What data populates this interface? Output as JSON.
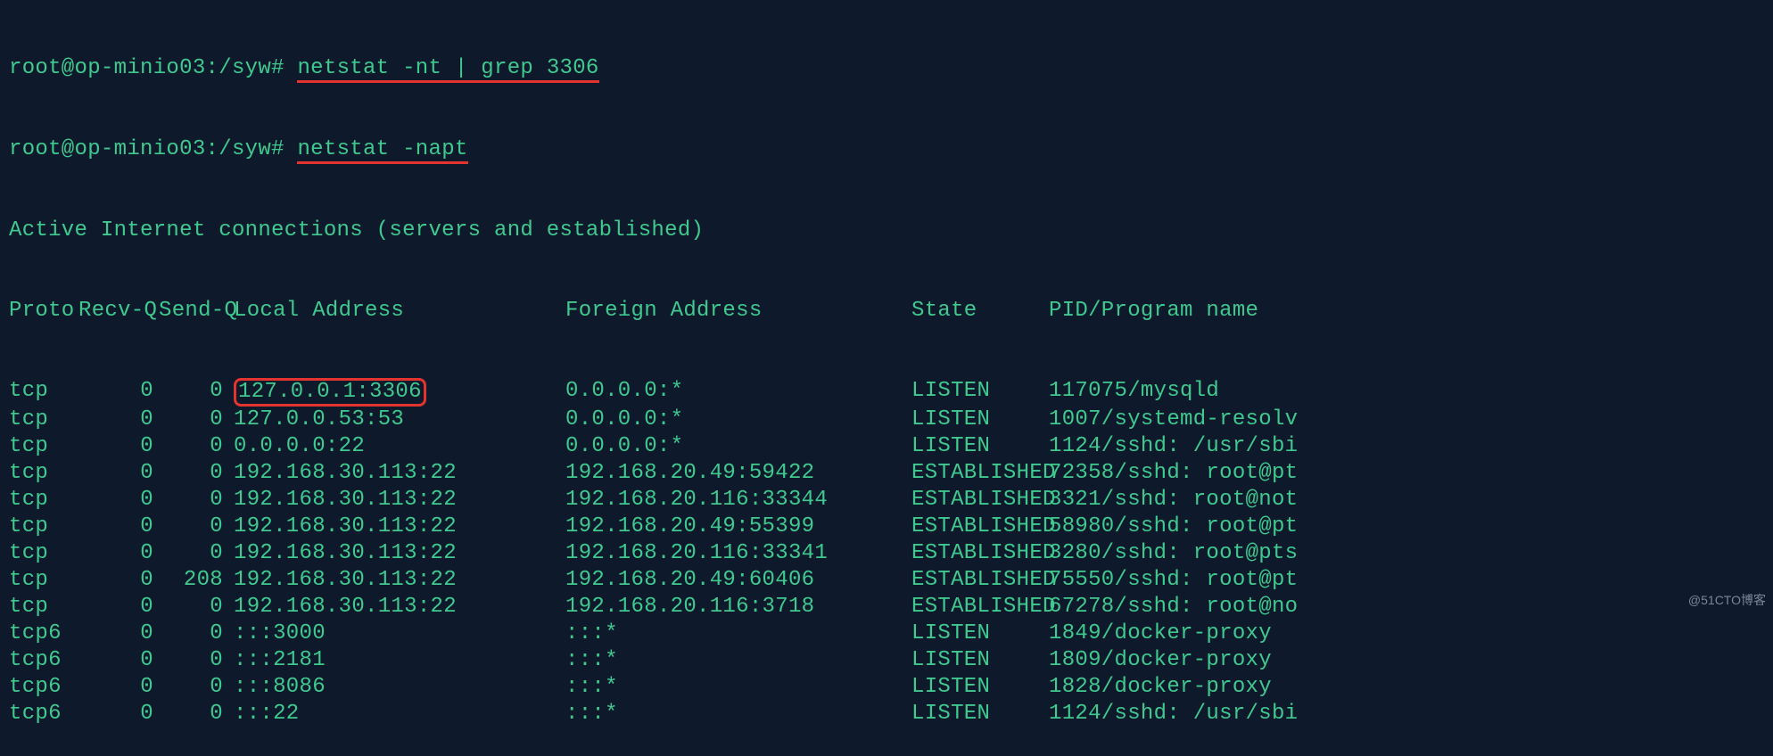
{
  "prompt1": {
    "user": "root@op-minio03",
    "path": ":/syw#",
    "cmd": "netstat -nt | grep 3306"
  },
  "prompt2": {
    "user": "root@op-minio03",
    "path": ":/syw#",
    "cmd": "netstat -napt"
  },
  "title": "Active Internet connections (servers and established)",
  "headers": {
    "proto": "Proto",
    "recvq": "Recv-Q",
    "sendq": "Send-Q",
    "local": "Local Address",
    "foreign": "Foreign Address",
    "state": "State",
    "pid": "PID/Program name"
  },
  "rows": [
    {
      "proto": "tcp",
      "recvq": "0",
      "sendq": "0",
      "local": "127.0.0.1:3306",
      "foreign": "0.0.0.0:*",
      "state": "LISTEN",
      "pid": "117075/mysqld",
      "boxed": true
    },
    {
      "proto": "tcp",
      "recvq": "0",
      "sendq": "0",
      "local": "127.0.0.53:53",
      "foreign": "0.0.0.0:*",
      "state": "LISTEN",
      "pid": "1007/systemd-resolv"
    },
    {
      "proto": "tcp",
      "recvq": "0",
      "sendq": "0",
      "local": "0.0.0.0:22",
      "foreign": "0.0.0.0:*",
      "state": "LISTEN",
      "pid": "1124/sshd: /usr/sbi"
    },
    {
      "proto": "tcp",
      "recvq": "0",
      "sendq": "0",
      "local": "192.168.30.113:22",
      "foreign": "192.168.20.49:59422",
      "state": "ESTABLISHED",
      "pid": "72358/sshd: root@pt"
    },
    {
      "proto": "tcp",
      "recvq": "0",
      "sendq": "0",
      "local": "192.168.30.113:22",
      "foreign": "192.168.20.116:33344",
      "state": "ESTABLISHED",
      "pid": "3321/sshd: root@not"
    },
    {
      "proto": "tcp",
      "recvq": "0",
      "sendq": "0",
      "local": "192.168.30.113:22",
      "foreign": "192.168.20.49:55399",
      "state": "ESTABLISHED",
      "pid": "58980/sshd: root@pt"
    },
    {
      "proto": "tcp",
      "recvq": "0",
      "sendq": "0",
      "local": "192.168.30.113:22",
      "foreign": "192.168.20.116:33341",
      "state": "ESTABLISHED",
      "pid": "3280/sshd: root@pts"
    },
    {
      "proto": "tcp",
      "recvq": "0",
      "sendq": "208",
      "local": "192.168.30.113:22",
      "foreign": "192.168.20.49:60406",
      "state": "ESTABLISHED",
      "pid": "75550/sshd: root@pt"
    },
    {
      "proto": "tcp",
      "recvq": "0",
      "sendq": "0",
      "local": "192.168.30.113:22",
      "foreign": "192.168.20.116:3718",
      "state": "ESTABLISHED",
      "pid": "67278/sshd: root@no"
    },
    {
      "proto": "tcp6",
      "recvq": "0",
      "sendq": "0",
      "local": ":::3000",
      "foreign": ":::*",
      "state": "LISTEN",
      "pid": "1849/docker-proxy"
    },
    {
      "proto": "tcp6",
      "recvq": "0",
      "sendq": "0",
      "local": ":::2181",
      "foreign": ":::*",
      "state": "LISTEN",
      "pid": "1809/docker-proxy"
    },
    {
      "proto": "tcp6",
      "recvq": "0",
      "sendq": "0",
      "local": ":::8086",
      "foreign": ":::*",
      "state": "LISTEN",
      "pid": "1828/docker-proxy"
    },
    {
      "proto": "tcp6",
      "recvq": "0",
      "sendq": "0",
      "local": ":::22",
      "foreign": ":::*",
      "state": "LISTEN",
      "pid": "1124/sshd: /usr/sbi"
    }
  ],
  "watermark": "@51CTO博客"
}
